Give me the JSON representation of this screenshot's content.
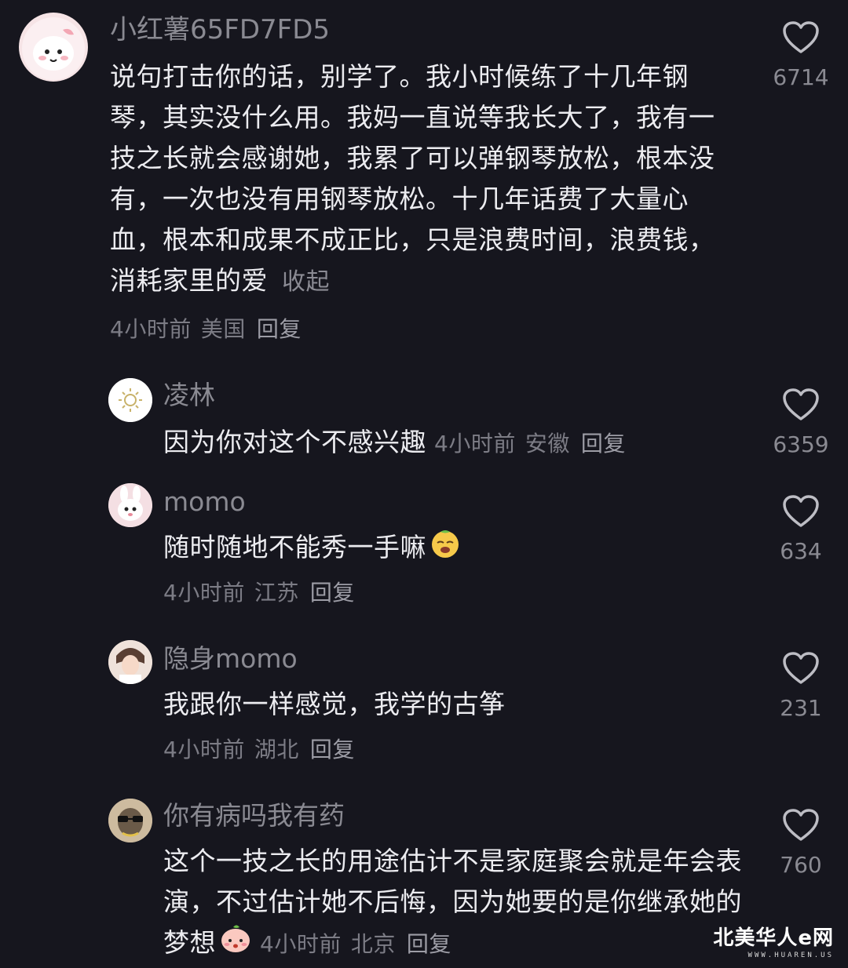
{
  "comments": [
    {
      "username": "小红薯65FD7FD5",
      "text": "说句打击你的话，别学了。我小时候练了十几年钢琴，其实没什么用。我妈一直说等我长大了，我有一技之长就会感谢她，我累了可以弹钢琴放松，根本没有，一次也没有用钢琴放松。十几年话费了大量心血，根本和成果不成正比，只是浪费时间，浪费钱，消耗家里的爱",
      "collapse_label": "收起",
      "time": "4小时前",
      "region": "美国",
      "reply_label": "回复",
      "likes": "6714",
      "avatar_icon": "pink-cartoon-avatar"
    },
    {
      "username": "凌林",
      "text": "因为你对这个不感兴趣",
      "time": "4小时前",
      "region": "安徽",
      "reply_label": "回复",
      "likes": "6359",
      "avatar_icon": "sun-avatar"
    },
    {
      "username": "momo",
      "text": "随时随地不能秀一手嘛",
      "time": "4小时前",
      "region": "江苏",
      "reply_label": "回复",
      "likes": "634",
      "avatar_icon": "bunny-avatar",
      "emoji": "smug-face-emoji"
    },
    {
      "username": "隐身momo",
      "text": "我跟你一样感觉，我学的古筝",
      "time": "4小时前",
      "region": "湖北",
      "reply_label": "回复",
      "likes": "231",
      "avatar_icon": "photo-avatar"
    },
    {
      "username": "你有病吗我有药",
      "text": "这个一技之长的用途估计不是家庭聚会就是年会表演，不过估计她不后悔，因为她要的是你继承她的梦想",
      "time": "4小时前",
      "region": "北京",
      "reply_label": "回复",
      "likes": "760",
      "avatar_icon": "sunglasses-avatar",
      "emoji": "peach-face-emoji"
    }
  ],
  "watermark": {
    "title": "北美华人e网",
    "subtitle": "WWW.HUAREN.US"
  },
  "colors": {
    "background": "#16161e",
    "text": "#ececf0",
    "meta": "#7c7c85",
    "username": "#8a8a92"
  }
}
